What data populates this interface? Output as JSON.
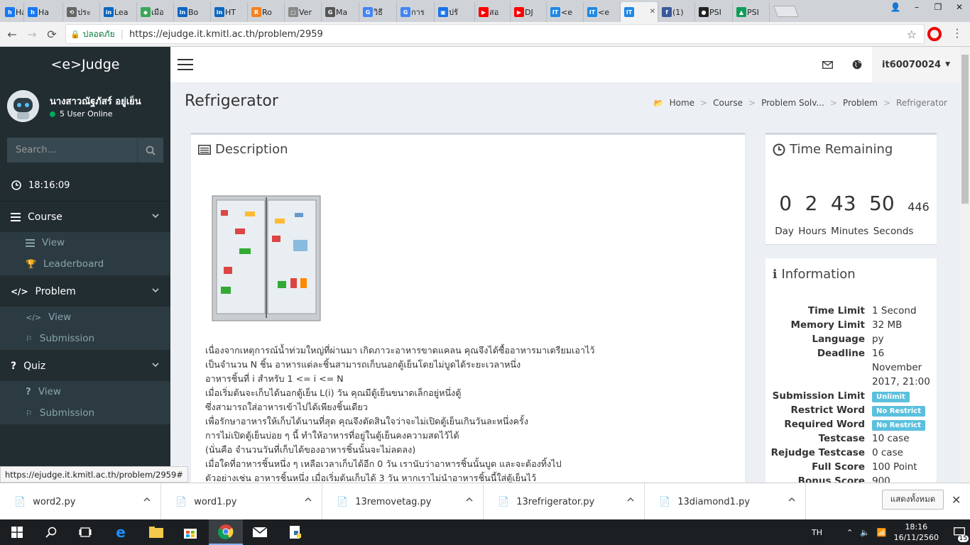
{
  "browser": {
    "tabs": [
      {
        "label": "Ha",
        "fav": "h",
        "color": "#1877f2"
      },
      {
        "label": "Ha",
        "fav": "h",
        "color": "#1877f2"
      },
      {
        "label": "ประ",
        "fav": "⟲",
        "color": "#666"
      },
      {
        "label": "Lea",
        "fav": "in",
        "color": "#0a66c2"
      },
      {
        "label": "เมือ",
        "fav": "◆",
        "color": "#3aa757"
      },
      {
        "label": "Bo",
        "fav": "in",
        "color": "#0a66c2"
      },
      {
        "label": "HT",
        "fav": "in",
        "color": "#0a66c2"
      },
      {
        "label": "Ro",
        "fav": "R",
        "color": "#f58220"
      },
      {
        "label": "Ver",
        "fav": "▢",
        "color": "#888"
      },
      {
        "label": "Ma",
        "fav": "G",
        "color": "#555"
      },
      {
        "label": "วิธี",
        "fav": "G",
        "color": "#4285f4"
      },
      {
        "label": "การ",
        "fav": "G",
        "color": "#4285f4"
      },
      {
        "label": "ปรั",
        "fav": "▣",
        "color": "#1a73e8"
      },
      {
        "label": "สอ",
        "fav": "▶",
        "color": "#ff0000"
      },
      {
        "label": "DJ",
        "fav": "▶",
        "color": "#ff0000"
      },
      {
        "label": "<e",
        "fav": "IT",
        "color": "#1e88e5"
      },
      {
        "label": "<e",
        "fav": "IT",
        "color": "#1e88e5"
      },
      {
        "label": "",
        "fav": "IT",
        "color": "#1e88e5"
      },
      {
        "label": "(1)",
        "fav": "f",
        "color": "#3b5998"
      },
      {
        "label": "PSI",
        "fav": "●",
        "color": "#222"
      },
      {
        "label": "PSI",
        "fav": "▲",
        "color": "#0f9d58"
      }
    ],
    "secure_label": "ปลอดภัย",
    "url": "https://ejudge.it.kmitl.ac.th/problem/2959",
    "status_url": "https://ejudge.it.kmitl.ac.th/problem/2959#"
  },
  "app": {
    "logo": "<e>Judge",
    "username": "นางสาวณัฐภัสร์ อยู่เย็น",
    "online_text": "5 User Online",
    "search_placeholder": "Search...",
    "clock": "18:16:09",
    "menu": {
      "course": {
        "label": "Course",
        "items": [
          "View",
          "Leaderboard"
        ]
      },
      "problem": {
        "label": "Problem",
        "items": [
          "View",
          "Submission"
        ]
      },
      "quiz": {
        "label": "Quiz",
        "items": [
          "View",
          "Submission"
        ]
      }
    },
    "top_user": "it60070024"
  },
  "page": {
    "title": "Refrigerator",
    "breadcrumb": [
      "Home",
      "Course",
      "Problem Solv...",
      "Problem",
      "Refrigerator"
    ],
    "description_title": "Description",
    "description_lines": [
      "เนื่องจากเหตุการณ์น้ำท่วมใหญ่ที่ผ่านมา เกิดภาวะอาหารขาดแคลน คุณจึงได้ซื้ออาหารมาเตรียมเอาไว้",
      "เป็นจำนวน N ชิ้น อาหารแต่ละชิ้นสามารถเก็บนอกตู้เย็นโดยไม่บูดได้ระยะเวลาหนึ่ง",
      "อาหารชิ้นที่ i สำหรับ 1 <= i <= N",
      "เมื่อเริ่มต้นจะเก็บได้นอกตู้เย็น L(i) วัน คุณมีตู้เย็นขนาดเล็กอยู่หนึ่งตู้",
      "ซึ่งสามารถใส่อาหารเข้าไปได้เพียงชิ้นเดียว",
      "เพื่อรักษาอาหารให้เก็บได้นานที่สุด คุณจึงตัดสินใจว่าจะไม่เปิดตู้เย็นเกินวันละหนึ่งครั้ง",
      "การไม่เปิดตู้เย็นบ่อย ๆ นี้ ทำให้อาหารที่อยู่ในตู้เย็นคงความสดไว้ได้",
      "(นั่นคือ จำนวนวันที่เก็บได้ของอาหารชิ้นนั้นจะไม่ลดลง)",
      "เมื่อใดที่อาหารชิ้นหนึ่ง ๆ เหลือเวลาเก็บได้อีก 0 วัน เรานับว่าอาหารชิ้นนั้นบูด และจะต้องทิ้งไป",
      "ตัวอย่างเช่น อาหารชิ้นหนึ่ง เมื่อเริ่มต้นเก็บได้ 3 วัน หากเราไม่นำอาหารชิ้นนี้ใส่ตู้เย็นไว้"
    ],
    "time_title": "Time Remaining",
    "time": {
      "day": "0",
      "hour": "2",
      "minute": "43",
      "second": "50",
      "ms": "446"
    },
    "time_labels": [
      "Day",
      "Hours",
      "Minutes",
      "Seconds"
    ],
    "info_title": "Information",
    "info": [
      {
        "k": "Time Limit",
        "v": "1 Second"
      },
      {
        "k": "Memory Limit",
        "v": "32 MB"
      },
      {
        "k": "Language",
        "v": "py"
      },
      {
        "k": "Deadline",
        "v": "16 November 2017, 21:00"
      },
      {
        "k": "Submission Limit",
        "badge": "Unlimit"
      },
      {
        "k": "Restrict Word",
        "badge": "No Restrict"
      },
      {
        "k": "Required Word",
        "badge": "No Restrict"
      },
      {
        "k": "Testcase",
        "v": "10 case"
      },
      {
        "k": "Rejudge Testcase",
        "v": "0 case"
      },
      {
        "k": "Full Score",
        "v": "100 Point"
      },
      {
        "k": "Bonus Score",
        "v": "900"
      }
    ]
  },
  "downloads": {
    "files": [
      "word2.py",
      "word1.py",
      "13removetag.py",
      "13refrigerator.py",
      "13diamond1.py"
    ],
    "show_all": "แสดงทั้งหมด"
  },
  "taskbar": {
    "lang": "TH",
    "time": "18:16",
    "date": "16/11/2560",
    "notif": "15"
  }
}
